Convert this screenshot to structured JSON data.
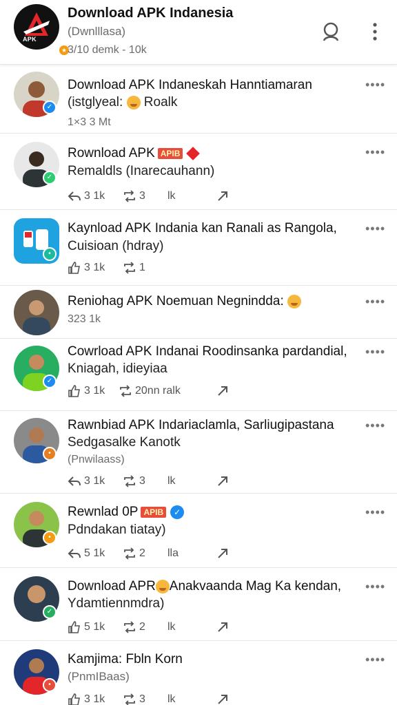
{
  "header": {
    "logo_text": "APK",
    "title": "Download APK Indanesia",
    "subtitle": "(Dwnlllasa)",
    "meta": "3/10 demk - 10k",
    "search_icon": "search-icon",
    "menu_icon": "vertical-dots-icon"
  },
  "posts": [
    {
      "line1": "Download APK Indaneskah Hanntiamaran",
      "line2": "(istglyeal: ",
      "line2b": " Roalk",
      "line3": "1×3 3 Mt",
      "avatar_color": "#5a7d4e",
      "dot_color": "#1d8cf0",
      "more": "••••"
    },
    {
      "line1": "Rownload APK",
      "tag": "APIB",
      "line2": "Remaldls  (Inarecauhann)",
      "likes": "3 1k",
      "shares": "3",
      "views": "lk",
      "avatar_color": "#7a8a9a",
      "dot_color": "#2ecc71",
      "more": "••••"
    },
    {
      "line1": "Kaynload APK Indania kan Ranali as Rangola,",
      "line2": "Cuisioan (hdray)",
      "likes": "3 1k",
      "shares": "1",
      "avatar_color": "#1fa3e0",
      "dot_color": "#1abc9c",
      "more": "••••"
    },
    {
      "line1": "Reniohag APK Noemuan Negnindda:",
      "line3": "323 1k",
      "avatar_color": "#6a5a4a",
      "dot_color": "#e74c3c",
      "more": "••••"
    },
    {
      "line1": "Cowrload APK Indanai Roodinsanka pardandial,",
      "line2": "Kniagah, idieyiaa",
      "likes": "3 1k",
      "shares": "20nn ralk",
      "avatar_color": "#27ae60",
      "dot_color": "#1d8cf0",
      "more": "••••"
    },
    {
      "line1": "Rawnbiad APK Indariaclamla, Sarliugipastana",
      "line2": "Sedgasalke Kanotk",
      "line3": "(Pnwilaass)",
      "likes": "3 1k",
      "shares": "3",
      "views": "lk",
      "avatar_color": "#8a8a8a",
      "dot_color": "#e67e22",
      "more": "••••"
    },
    {
      "line1": "Rewnlad 0P",
      "tag": "APIB",
      "line2": "Pdndakan tiatay)",
      "likes": "5 1k",
      "shares": "2",
      "views": "lla",
      "avatar_color": "#8bc34a",
      "dot_color": "#f39c12",
      "more": "••••"
    },
    {
      "line1": "Download APR",
      "line1b": "Anakvaanda Mag Ka kendan,",
      "line2": "Ydamtiennmdra)",
      "likes": "5 1k",
      "shares": "2",
      "views": "lk",
      "avatar_color": "#2c3e50",
      "dot_color": "#27ae60",
      "more": "••••"
    },
    {
      "line1": "Kamjima: Fbln Korn",
      "line2": "(PnmIBaas)",
      "likes": "3 1k",
      "shares": "3",
      "views": "lk",
      "avatar_color": "#1f3b7a",
      "dot_color": "#e74c3c",
      "more": "••••"
    }
  ]
}
